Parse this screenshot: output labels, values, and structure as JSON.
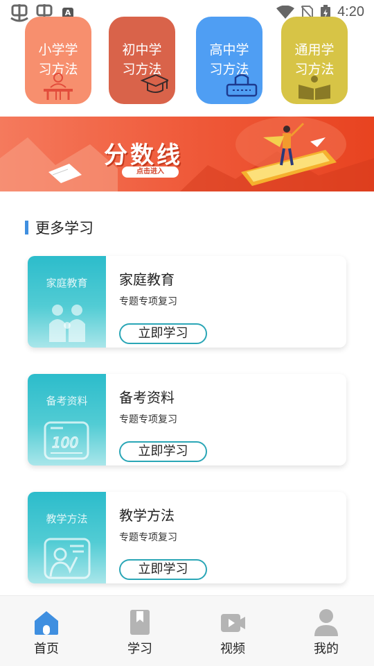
{
  "status_bar": {
    "time": "4:20",
    "notification_letter": "A"
  },
  "categories": [
    {
      "label": "小学学习方法",
      "line1": "小学学",
      "line2": "习方法",
      "color": "#f78f6e"
    },
    {
      "label": "初中学习方法",
      "line1": "初中学",
      "line2": "习方法",
      "color": "#d9634a"
    },
    {
      "label": "高中学习方法",
      "line1": "高中学",
      "line2": "习方法",
      "color": "#4f9ef3"
    },
    {
      "label": "通用学习方法",
      "line1": "通用学",
      "line2": "习方法",
      "color": "#d7c446"
    }
  ],
  "banner": {
    "title": "分数线",
    "cta": "点击进入"
  },
  "section": {
    "title": "更多学习"
  },
  "cards": [
    {
      "title": "家庭教育",
      "subtitle": "专题专项复习",
      "thumb_label": "家庭教育",
      "button": "立即学习",
      "icon": "family-icon"
    },
    {
      "title": "备考资料",
      "subtitle": "专题专项复习",
      "thumb_label": "备考资料",
      "button": "立即学习",
      "icon": "score-100-icon"
    },
    {
      "title": "教学方法",
      "subtitle": "专题专项复习",
      "thumb_label": "教学方法",
      "button": "立即学习",
      "icon": "teacher-board-icon"
    }
  ],
  "nav": [
    {
      "label": "首页",
      "icon": "home-icon",
      "active": true,
      "color": "#3f8fe0"
    },
    {
      "label": "学习",
      "icon": "bookmark-icon",
      "active": false,
      "color": "#b4b4b4"
    },
    {
      "label": "视频",
      "icon": "video-icon",
      "active": false,
      "color": "#b4b4b4"
    },
    {
      "label": "我的",
      "icon": "user-icon",
      "active": false,
      "color": "#b4b4b4"
    }
  ]
}
